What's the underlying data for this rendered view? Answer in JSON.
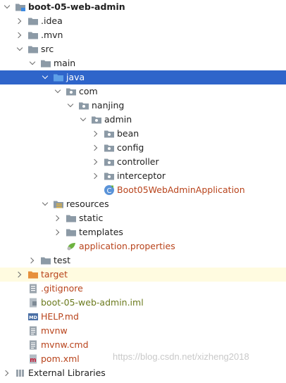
{
  "tree": {
    "nodes": [
      {
        "label": "boot-05-web-admin",
        "depth": 0,
        "arrow": "open",
        "icon": "module-folder-icon",
        "style": "bold"
      },
      {
        "label": ".idea",
        "depth": 1,
        "arrow": "closed",
        "icon": "folder-icon"
      },
      {
        "label": ".mvn",
        "depth": 1,
        "arrow": "closed",
        "icon": "folder-icon"
      },
      {
        "label": "src",
        "depth": 1,
        "arrow": "open",
        "icon": "folder-icon"
      },
      {
        "label": "main",
        "depth": 2,
        "arrow": "open",
        "icon": "folder-icon"
      },
      {
        "label": "java",
        "depth": 3,
        "arrow": "open",
        "icon": "source-folder-icon",
        "selected": true
      },
      {
        "label": "com",
        "depth": 4,
        "arrow": "open",
        "icon": "package-icon"
      },
      {
        "label": "nanjing",
        "depth": 5,
        "arrow": "open",
        "icon": "package-icon"
      },
      {
        "label": "admin",
        "depth": 6,
        "arrow": "open",
        "icon": "package-icon"
      },
      {
        "label": "bean",
        "depth": 7,
        "arrow": "closed",
        "icon": "package-icon"
      },
      {
        "label": "config",
        "depth": 7,
        "arrow": "closed",
        "icon": "package-icon"
      },
      {
        "label": "controller",
        "depth": 7,
        "arrow": "closed",
        "icon": "package-icon"
      },
      {
        "label": "interceptor",
        "depth": 7,
        "arrow": "closed",
        "icon": "package-icon"
      },
      {
        "label": "Boot05WebAdminApplication",
        "depth": 7,
        "arrow": "none",
        "icon": "spring-boot-class-icon",
        "style": "red"
      },
      {
        "label": "resources",
        "depth": 3,
        "arrow": "open",
        "icon": "resources-folder-icon"
      },
      {
        "label": "static",
        "depth": 4,
        "arrow": "closed",
        "icon": "folder-icon"
      },
      {
        "label": "templates",
        "depth": 4,
        "arrow": "closed",
        "icon": "folder-icon"
      },
      {
        "label": "application.properties",
        "depth": 4,
        "arrow": "none",
        "icon": "spring-properties-icon",
        "style": "red"
      },
      {
        "label": "test",
        "depth": 2,
        "arrow": "closed",
        "icon": "folder-icon"
      },
      {
        "label": "target",
        "depth": 1,
        "arrow": "closed",
        "icon": "excluded-folder-icon",
        "style": "red",
        "excluded": true
      },
      {
        "label": ".gitignore",
        "depth": 1,
        "arrow": "none",
        "icon": "gitignore-icon",
        "style": "red"
      },
      {
        "label": "boot-05-web-admin.iml",
        "depth": 1,
        "arrow": "none",
        "icon": "iml-file-icon",
        "style": "olive"
      },
      {
        "label": "HELP.md",
        "depth": 1,
        "arrow": "none",
        "icon": "markdown-icon",
        "style": "red"
      },
      {
        "label": "mvnw",
        "depth": 1,
        "arrow": "none",
        "icon": "text-file-icon",
        "style": "red"
      },
      {
        "label": "mvnw.cmd",
        "depth": 1,
        "arrow": "none",
        "icon": "text-file-icon",
        "style": "red"
      },
      {
        "label": "pom.xml",
        "depth": 1,
        "arrow": "none",
        "icon": "maven-icon",
        "style": "red"
      },
      {
        "label": "External Libraries",
        "depth": 0,
        "arrow": "closed",
        "icon": "library-icon"
      }
    ]
  },
  "watermark": "https://blog.csdn.net/xizheng2018",
  "colors": {
    "selection": "#2f65ca",
    "folder": "#8c9aa6",
    "excluded_folder": "#e7903a",
    "modified_text": "#b8431b"
  }
}
